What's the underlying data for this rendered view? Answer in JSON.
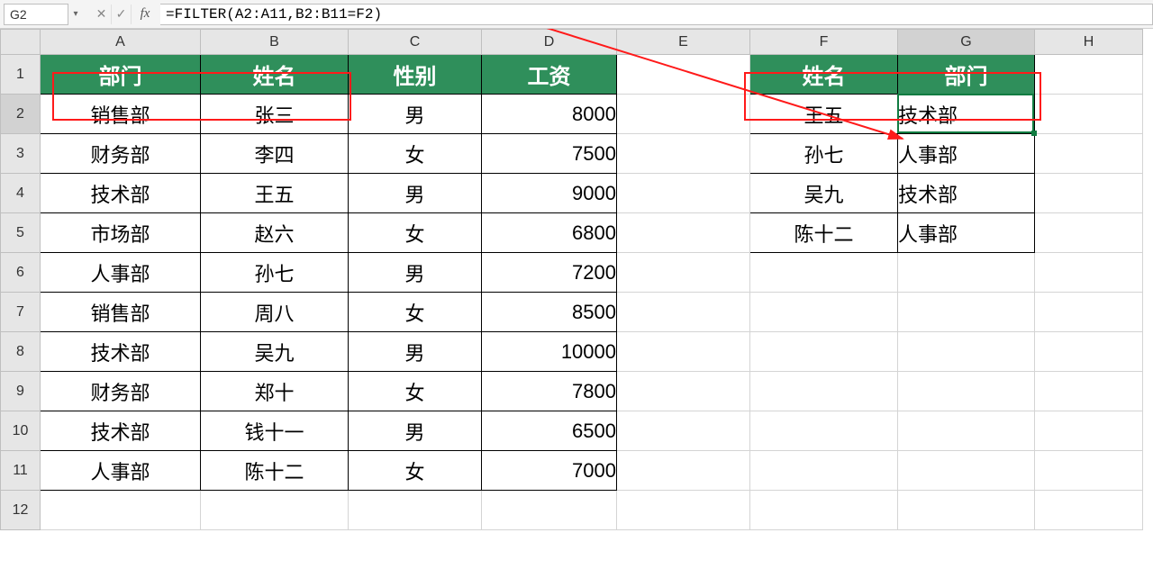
{
  "namebox": {
    "value": "G2"
  },
  "formula_bar": {
    "cancel_glyph": "✕",
    "confirm_glyph": "✓",
    "fx_label": "fx",
    "formula": "=FILTER(A2:A11,B2:B11=F2)"
  },
  "columns": [
    "A",
    "B",
    "C",
    "D",
    "E",
    "F",
    "G",
    "H"
  ],
  "rows": [
    "1",
    "2",
    "3",
    "4",
    "5",
    "6",
    "7",
    "8",
    "9",
    "10",
    "11",
    "12"
  ],
  "main_table": {
    "headers": [
      "部门",
      "姓名",
      "性别",
      "工资"
    ],
    "rows": [
      {
        "dept": "销售部",
        "name": "张三",
        "gender": "男",
        "salary": "8000"
      },
      {
        "dept": "财务部",
        "name": "李四",
        "gender": "女",
        "salary": "7500"
      },
      {
        "dept": "技术部",
        "name": "王五",
        "gender": "男",
        "salary": "9000"
      },
      {
        "dept": "市场部",
        "name": "赵六",
        "gender": "女",
        "salary": "6800"
      },
      {
        "dept": "人事部",
        "name": "孙七",
        "gender": "男",
        "salary": "7200"
      },
      {
        "dept": "销售部",
        "name": "周八",
        "gender": "女",
        "salary": "8500"
      },
      {
        "dept": "技术部",
        "name": "吴九",
        "gender": "男",
        "salary": "10000"
      },
      {
        "dept": "财务部",
        "name": "郑十",
        "gender": "女",
        "salary": "7800"
      },
      {
        "dept": "技术部",
        "name": "钱十一",
        "gender": "男",
        "salary": "6500"
      },
      {
        "dept": "人事部",
        "name": "陈十二",
        "gender": "女",
        "salary": "7000"
      }
    ]
  },
  "lookup_table": {
    "headers": [
      "姓名",
      "部门"
    ],
    "rows": [
      {
        "name": "王五",
        "dept": "技术部"
      },
      {
        "name": "孙七",
        "dept": "人事部"
      },
      {
        "name": "吴九",
        "dept": "技术部"
      },
      {
        "name": "陈十二",
        "dept": "人事部"
      }
    ]
  },
  "selected_cell": "G2"
}
